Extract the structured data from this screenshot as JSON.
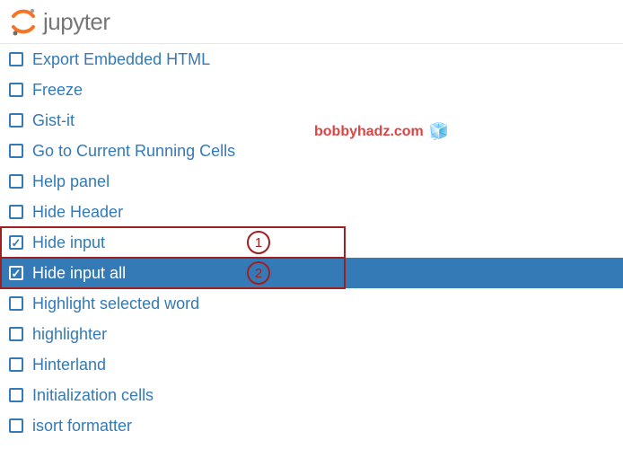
{
  "logo": {
    "text": "jupyter"
  },
  "attribution": {
    "text": "bobbyhadz.com",
    "icon": "🧊"
  },
  "items": [
    {
      "label": "Export Embedded HTML",
      "checked": false,
      "hovered": false,
      "annot": null
    },
    {
      "label": "Freeze",
      "checked": false,
      "hovered": false,
      "annot": null
    },
    {
      "label": "Gist-it",
      "checked": false,
      "hovered": false,
      "annot": null
    },
    {
      "label": "Go to Current Running Cells",
      "checked": false,
      "hovered": false,
      "annot": null
    },
    {
      "label": "Help panel",
      "checked": false,
      "hovered": false,
      "annot": null
    },
    {
      "label": "Hide Header",
      "checked": false,
      "hovered": false,
      "annot": null
    },
    {
      "label": "Hide input",
      "checked": true,
      "hovered": false,
      "annot": "1"
    },
    {
      "label": "Hide input all",
      "checked": true,
      "hovered": true,
      "annot": "2"
    },
    {
      "label": "Highlight selected word",
      "checked": false,
      "hovered": false,
      "annot": null
    },
    {
      "label": "highlighter",
      "checked": false,
      "hovered": false,
      "annot": null
    },
    {
      "label": "Hinterland",
      "checked": false,
      "hovered": false,
      "annot": null
    },
    {
      "label": "Initialization cells",
      "checked": false,
      "hovered": false,
      "annot": null
    },
    {
      "label": "isort formatter",
      "checked": false,
      "hovered": false,
      "annot": null
    }
  ]
}
